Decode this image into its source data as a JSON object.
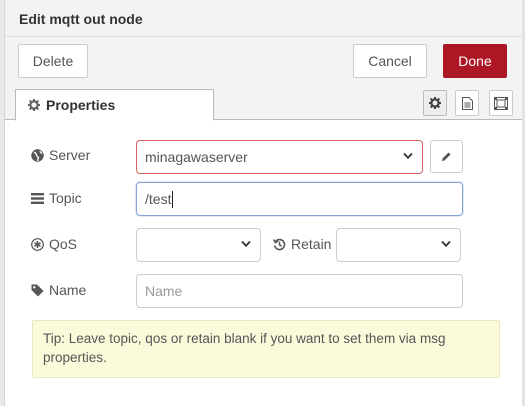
{
  "dialog": {
    "title": "Edit mqtt out node"
  },
  "toolbar": {
    "delete_label": "Delete",
    "cancel_label": "Cancel",
    "done_label": "Done"
  },
  "tabs": {
    "properties_label": "Properties",
    "icons": [
      "gear-icon",
      "description-icon",
      "appearance-icon"
    ]
  },
  "form": {
    "server": {
      "label": "Server",
      "value": "minagawaserver",
      "icon": "globe-icon"
    },
    "topic": {
      "label": "Topic",
      "value": "/test",
      "icon": "tasks-icon"
    },
    "qos": {
      "label": "QoS",
      "value": "",
      "icon": "asterisk-icon"
    },
    "retain": {
      "label": "Retain",
      "value": "",
      "icon": "history-icon"
    },
    "name": {
      "label": "Name",
      "placeholder": "Name",
      "icon": "tag-icon"
    }
  },
  "tip": {
    "text": "Tip: Leave topic, qos or retain blank if you want to set them via msg properties."
  },
  "colors": {
    "primary": "#ad1625",
    "error_border": "#d6615f",
    "tip_bg": "#fbfbdc",
    "focus_border": "#85a6d6"
  }
}
